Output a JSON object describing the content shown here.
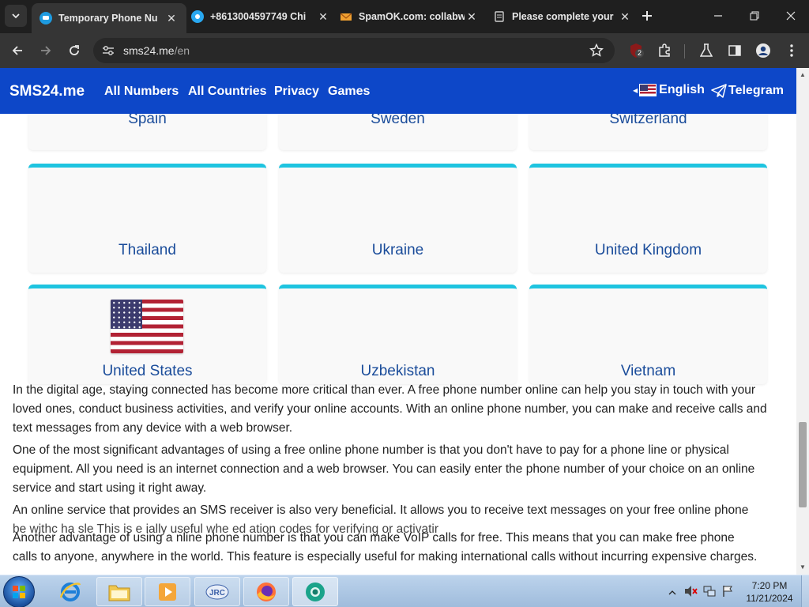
{
  "browser": {
    "tabs": [
      {
        "title": "Temporary Phone Nu",
        "active": true,
        "favicon": "sms24-icon"
      },
      {
        "title": "+8613004597749 Chi",
        "active": false,
        "favicon": "phone-site-icon"
      },
      {
        "title": "SpamOK.com: collabw",
        "active": false,
        "favicon": "spamok-icon"
      },
      {
        "title": "Please complete your",
        "active": false,
        "favicon": "doc-page-icon"
      }
    ],
    "url_host": "sms24.me",
    "url_path": "/en",
    "extension_badge": "2"
  },
  "site": {
    "brand": "SMS24.me",
    "nav": [
      "All Numbers",
      "All Countries",
      "Privacy",
      "Games"
    ],
    "language": "English",
    "telegram": "Telegram"
  },
  "countries": {
    "row_top": [
      "Spain",
      "Sweden",
      "Switzerland"
    ],
    "row_mid": [
      "Thailand",
      "Ukraine",
      "United Kingdom"
    ],
    "row_bottom": [
      "United States",
      "Uzbekistan",
      "Vietnam"
    ]
  },
  "article": {
    "p1_line1": "In the digital age, staying connected has become more critical than ever. A free phone number online can help you stay in touch with your",
    "p1_line2": "loved ones, conduct business activities, and verify your online accounts. With an online phone number, you can make and receive calls and",
    "p1_line3": "text messages from any device with a web browser.",
    "p2_line1": "One of the most significant advantages of using a free online phone number is that you don't have to pay for a phone line or physical",
    "p2_line2": "equipment. All you need is an internet connection and a web browser. You can easily enter the phone number of your choice on an online",
    "p2_line3": "service and start using it right away.",
    "p3_line1": "An online service that provides an SMS receiver is also very beneficial. It allows you to receive text messages on your free online phone",
    "p3_line2": "be withc    ha sle  This is e    ially useful whe       ed        ation codes for verifying or activatir",
    "p4_line1": "Another advantage of using a     nline phone number is that you can make VoIP calls for free. This means that you can make free phone",
    "p4_line2": "calls to anyone, anywhere in the world. This feature is especially useful for making international calls without incurring expensive charges."
  },
  "taskbar": {
    "time": "7:20 PM",
    "date": "11/21/2024"
  }
}
